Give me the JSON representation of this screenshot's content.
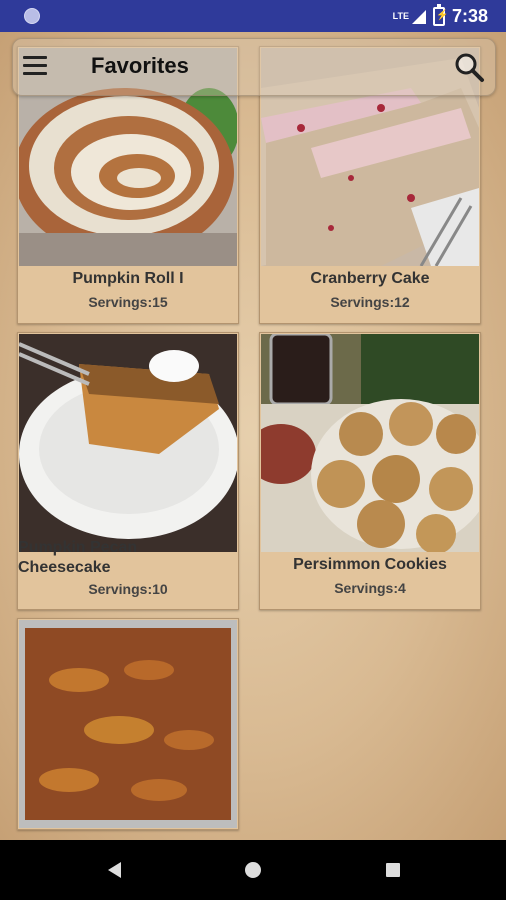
{
  "status_bar": {
    "time": "7:38",
    "network": "LTE"
  },
  "app_bar": {
    "title": "Favorites",
    "menu_icon": "hamburger-menu-icon",
    "search_icon": "search-icon"
  },
  "servings_prefix": "Servings:",
  "recipes": [
    {
      "title": "Pumpkin Roll I",
      "servings": "Servings:15"
    },
    {
      "title": "Cranberry Cake",
      "servings": "Servings:12"
    },
    {
      "title_line1": "Pumpkin Pecan",
      "title_line2": "Cheesecake",
      "servings": "Servings:10"
    },
    {
      "title": "Persimmon Cookies",
      "servings": "Servings:4"
    },
    {
      "title": "",
      "servings": ""
    }
  ],
  "colors": {
    "status_bar": "#2f3a9a",
    "paper": "#d9b992",
    "card": "#e2c49c",
    "text": "#333333"
  }
}
